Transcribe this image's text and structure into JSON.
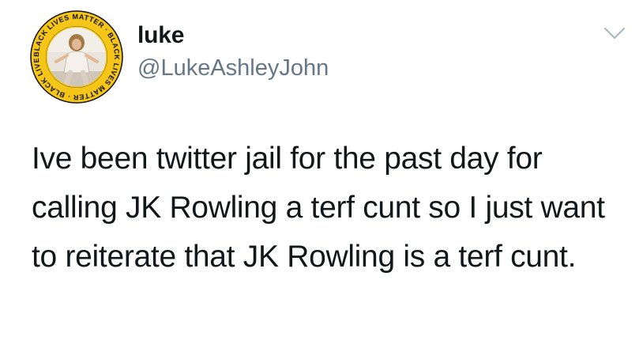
{
  "author": {
    "display_name": "luke",
    "handle": "@LukeAshleyJohn",
    "avatar_ring_text": "BLACK LIVES MATTER · BLACK LIVES MATTER · BLACK LIVES MATTER ·"
  },
  "tweet": {
    "text": "Ive been twitter jail for the past day for calling JK Rowling a terf cunt so I just want to reiterate that JK Rowling is a terf cunt."
  },
  "icons": {
    "menu": "chevron-down-icon",
    "avatar": "profile-photo"
  },
  "colors": {
    "text": "#14171a",
    "secondary_text": "#657786",
    "avatar_ring": "#f5c518",
    "caret": "#aab8c2"
  }
}
